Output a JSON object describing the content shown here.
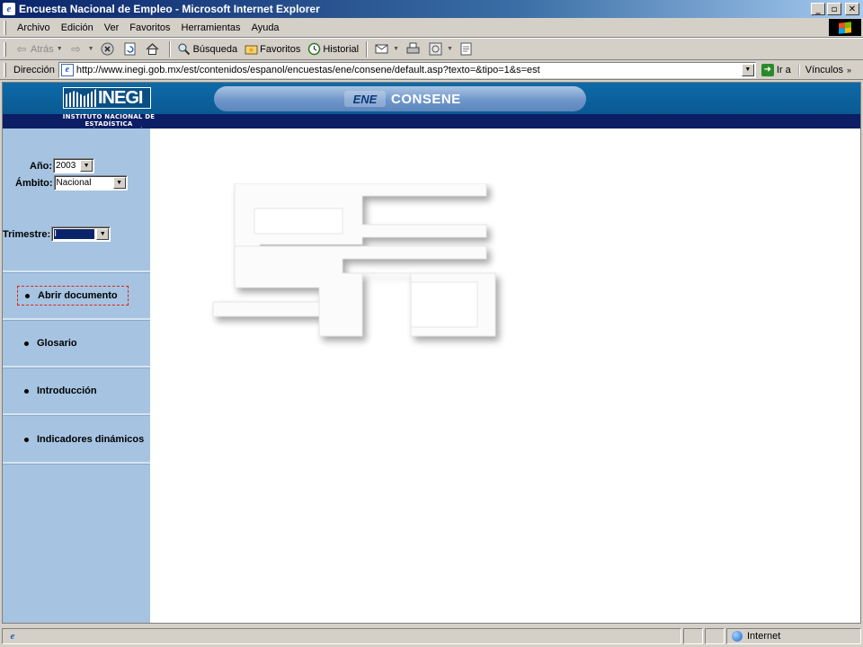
{
  "window": {
    "title": "Encuesta Nacional de Empleo - Microsoft Internet Explorer",
    "controls": {
      "minimize": "_",
      "maximize": "▫",
      "close": "✕"
    }
  },
  "menu": [
    "Archivo",
    "Edición",
    "Ver",
    "Favoritos",
    "Herramientas",
    "Ayuda"
  ],
  "toolbar": {
    "back": "Atrás",
    "search": "Búsqueda",
    "favorites": "Favoritos",
    "history": "Historial"
  },
  "address": {
    "label": "Dirección",
    "url": "http://www.inegi.gob.mx/est/contenidos/espanol/encuestas/ene/consene/default.asp?texto=&tipo=1&s=est",
    "go": "Ir a",
    "links": "Vínculos"
  },
  "header": {
    "logo_text": "INEGI",
    "logo_sub_line1": "INSTITUTO NACIONAL DE ESTADÍSTICA",
    "logo_sub_line2": "GEOGRAFÍA E INFORMÁTICA",
    "ene_mark": "ENE",
    "app_name": "CONSENE"
  },
  "sidebar": {
    "year_label": "Año:",
    "year_value": "2003",
    "scope_label": "Ámbito:",
    "scope_value": "Nacional",
    "quarter_label": "Trimestre:",
    "quarter_value": "I",
    "nav": [
      {
        "label": "Abrir documento"
      },
      {
        "label": "Glosario"
      },
      {
        "label": "Introducción"
      },
      {
        "label": "Indicadores dinámicos"
      }
    ]
  },
  "statusbar": {
    "zone": "Internet"
  }
}
